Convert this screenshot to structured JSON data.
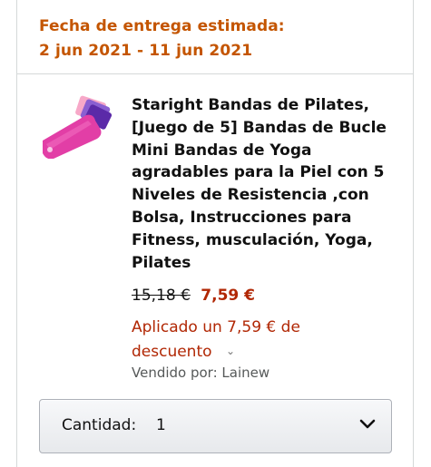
{
  "delivery": {
    "label": "Fecha de entrega estimada:",
    "dates": "2 jun 2021 - 11 jun 2021"
  },
  "product": {
    "image_icon": "product-thumbnail-resistance-bands",
    "title_lines": [
      "Staright Bandas de Pilates,",
      "[Juego de 5] Bandas de Bucle",
      "Mini Bandas de Yoga",
      "agradables para la Piel con 5",
      "Niveles de Resistencia ,con",
      "Bolsa, Instrucciones para",
      "Fitness, musculación, Yoga,",
      "Pilates"
    ],
    "old_price": "15,18 €",
    "price": "7,59 €",
    "discount_line1": "Aplicado un 7,59 € de",
    "discount_line2": "descuento",
    "discount_icon": "chevron-down-small-icon",
    "seller": "Vendido por: Lainew"
  },
  "quantity": {
    "label": "Cantidad:",
    "value": "1",
    "icon": "chevron-down-icon"
  },
  "colors": {
    "delivery_accent": "#c45500",
    "price_red": "#b12704",
    "border": "#d5d9d9"
  }
}
